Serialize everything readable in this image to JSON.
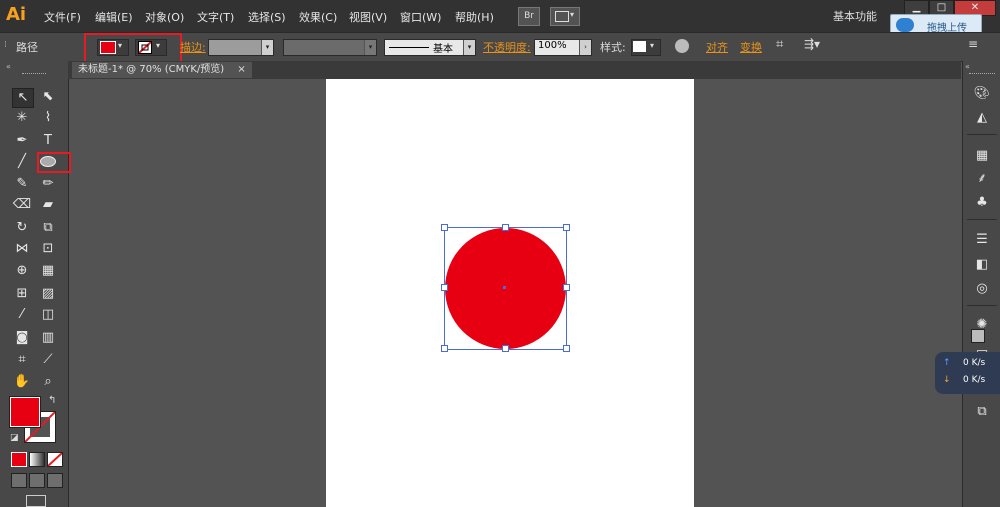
{
  "app": {
    "logo": "Ai",
    "workspace": "基本功能",
    "upload_label": "拖拽上传",
    "bridge_label": "Br"
  },
  "menu": [
    "文件(F)",
    "编辑(E)",
    "对象(O)",
    "文字(T)",
    "选择(S)",
    "效果(C)",
    "视图(V)",
    "窗口(W)",
    "帮助(H)"
  ],
  "window_buttons": [
    "▁",
    "□",
    "✕"
  ],
  "control": {
    "selection_label": "路径",
    "stroke_label": "描边:",
    "stroke_style": "基本",
    "opacity_label": "不透明度:",
    "opacity_value": "100%",
    "style_label": "样式:",
    "align_label": "对齐",
    "transform_label": "变换"
  },
  "colors": {
    "fill": "#e60012",
    "accent": "#f7a021",
    "highlight": "#e51c23",
    "selection": "#4a6bd8"
  },
  "document": {
    "tab": "未标题-1* @ 70% (CMYK/预览)",
    "close": "×"
  },
  "network": {
    "up": "0 K/s",
    "down": "0 K/s",
    "up_icon": "↑",
    "down_icon": "↓"
  }
}
